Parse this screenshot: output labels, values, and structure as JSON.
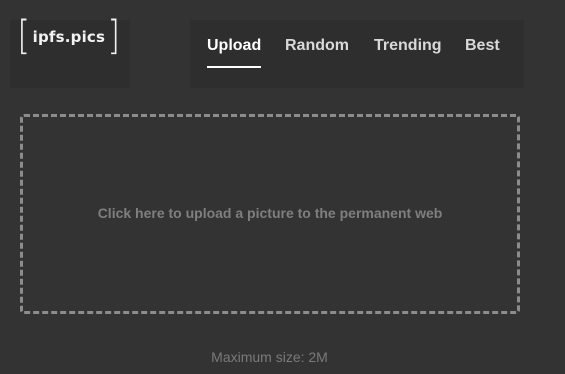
{
  "logo": {
    "left_bracket": "[",
    "text": "ipfs.pics",
    "right_bracket": "]"
  },
  "nav": {
    "items": [
      {
        "label": "Upload",
        "active": true
      },
      {
        "label": "Random",
        "active": false
      },
      {
        "label": "Trending",
        "active": false
      },
      {
        "label": "Best",
        "active": false
      }
    ]
  },
  "upload": {
    "prompt": "Click here to upload a picture to the permanent web",
    "max_size": "Maximum size: 2M"
  },
  "colors": {
    "background": "#333333",
    "panel": "#2e2e2e",
    "active_text": "#ffffff",
    "nav_text": "#d9d9d9",
    "dashed_border": "#8c8c8c",
    "muted_text": "#7f7f7f"
  }
}
